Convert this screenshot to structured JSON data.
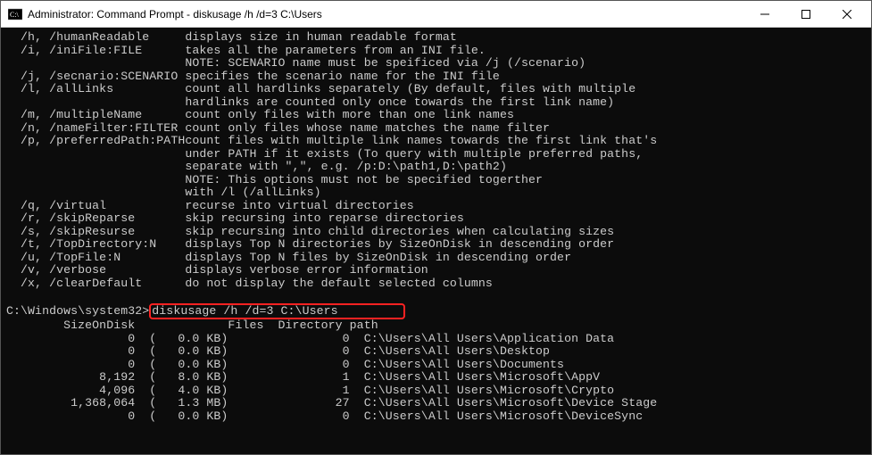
{
  "titlebar": {
    "title": "Administrator: Command Prompt - diskusage /h /d=3 C:\\Users"
  },
  "options": [
    {
      "flags": "  /h, /humanReadable     ",
      "lines": [
        "displays size in human readable format"
      ]
    },
    {
      "flags": "  /i, /iniFile:FILE      ",
      "lines": [
        "takes all the parameters from an INI file.",
        "NOTE: SCENARIO name must be speificed via /j (/scenario)"
      ]
    },
    {
      "flags": "  /j, /secnario:SCENARIO ",
      "lines": [
        "specifies the scenario name for the INI file"
      ]
    },
    {
      "flags": "  /l, /allLinks          ",
      "lines": [
        "count all hardlinks separately (By default, files with multiple",
        "hardlinks are counted only once towards the first link name)"
      ]
    },
    {
      "flags": "  /m, /multipleName      ",
      "lines": [
        "count only files with more than one link names"
      ]
    },
    {
      "flags": "  /n, /nameFilter:FILTER ",
      "lines": [
        "count only files whose name matches the name filter"
      ]
    },
    {
      "flags": "  /p, /preferredPath:PATH",
      "lines": [
        "count files with multiple link names towards the first link that's",
        "under PATH if it exists (To query with multiple preferred paths,",
        "separate with \",\", e.g. /p:D:\\path1,D:\\path2)",
        "NOTE: This options must not be specified togerther",
        "with /l (/allLinks)"
      ]
    },
    {
      "flags": "  /q, /virtual           ",
      "lines": [
        "recurse into virtual directories"
      ]
    },
    {
      "flags": "  /r, /skipReparse       ",
      "lines": [
        "skip recursing into reparse directories"
      ]
    },
    {
      "flags": "  /s, /skipResurse       ",
      "lines": [
        "skip recursing into child directories when calculating sizes"
      ]
    },
    {
      "flags": "  /t, /TopDirectory:N    ",
      "lines": [
        "displays Top N directories by SizeOnDisk in descending order"
      ]
    },
    {
      "flags": "  /u, /TopFile:N         ",
      "lines": [
        "displays Top N files by SizeOnDisk in descending order"
      ]
    },
    {
      "flags": "  /v, /verbose           ",
      "lines": [
        "displays verbose error information"
      ]
    },
    {
      "flags": "  /x, /clearDefault      ",
      "lines": [
        "do not display the default selected columns"
      ]
    }
  ],
  "prompt": {
    "path": "C:\\Windows\\system32>",
    "command": "diskusage /h /d=3 C:\\Users"
  },
  "table_header": "        SizeOnDisk             Files  Directory path",
  "rows": [
    {
      "size": "                 0  (   0.0 KB)",
      "files": "                0  ",
      "path": "C:\\Users\\All Users\\Application Data"
    },
    {
      "size": "                 0  (   0.0 KB)",
      "files": "                0  ",
      "path": "C:\\Users\\All Users\\Desktop"
    },
    {
      "size": "                 0  (   0.0 KB)",
      "files": "                0  ",
      "path": "C:\\Users\\All Users\\Documents"
    },
    {
      "size": "             8,192  (   8.0 KB)",
      "files": "                1  ",
      "path": "C:\\Users\\All Users\\Microsoft\\AppV"
    },
    {
      "size": "             4,096  (   4.0 KB)",
      "files": "                1  ",
      "path": "C:\\Users\\All Users\\Microsoft\\Crypto"
    },
    {
      "size": "         1,368,064  (   1.3 MB)",
      "files": "               27  ",
      "path": "C:\\Users\\All Users\\Microsoft\\Device Stage"
    },
    {
      "size": "                 0  (   0.0 KB)",
      "files": "                0  ",
      "path": "C:\\Users\\All Users\\Microsoft\\DeviceSync"
    }
  ]
}
